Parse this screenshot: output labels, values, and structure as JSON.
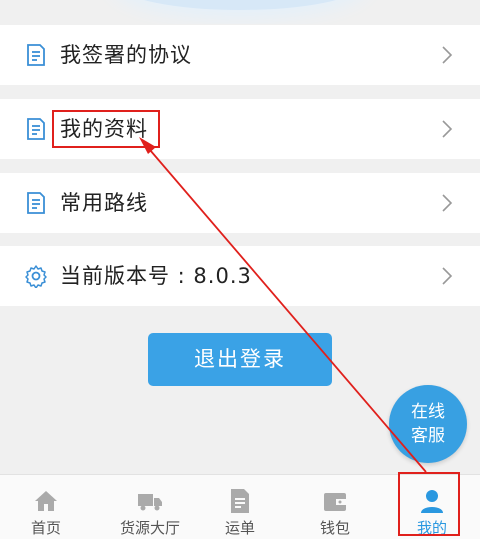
{
  "menu": {
    "items": [
      {
        "label": "我签署的协议",
        "icon": "document-icon"
      },
      {
        "label": "我的资料",
        "icon": "document-icon"
      },
      {
        "label": "常用路线",
        "icon": "document-icon"
      },
      {
        "label": "当前版本号 : 8.0.3",
        "icon": "gear-icon"
      }
    ]
  },
  "logout": {
    "label": "退出登录"
  },
  "service": {
    "line1": "在线",
    "line2": "客服"
  },
  "tabbar": {
    "tabs": [
      {
        "label": "首页",
        "icon": "home-icon"
      },
      {
        "label": "货源大厅",
        "icon": "truck-icon"
      },
      {
        "label": "运单",
        "icon": "waybill-icon"
      },
      {
        "label": "钱包",
        "icon": "wallet-icon"
      },
      {
        "label": "我的",
        "icon": "user-icon",
        "active": true
      }
    ]
  },
  "colors": {
    "accent": "#3aa2e6",
    "annotation": "#e0201c",
    "inactive": "#999999"
  }
}
